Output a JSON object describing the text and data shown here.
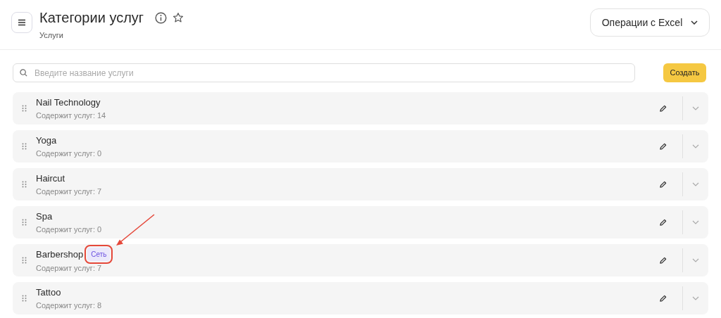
{
  "header": {
    "title": "Категории услуг",
    "subtitle": "Услуги",
    "excel_button": "Операции с Excel"
  },
  "search": {
    "placeholder": "Введите название услуги"
  },
  "create_button": "Создать",
  "categories": [
    {
      "name": "Nail Technology",
      "count": "Содержит услуг: 14"
    },
    {
      "name": "Yoga",
      "count": "Содержит услуг: 0"
    },
    {
      "name": "Haircut",
      "count": "Содержит услуг: 7"
    },
    {
      "name": "Spa",
      "count": "Содержит услуг: 0"
    },
    {
      "name": "Barbershop",
      "count": "Содержит услуг: 7",
      "badge": {
        "text": "Сеть",
        "annotated": true
      }
    },
    {
      "name": "Tattoo",
      "count": "Содержит услуг: 8"
    }
  ]
}
